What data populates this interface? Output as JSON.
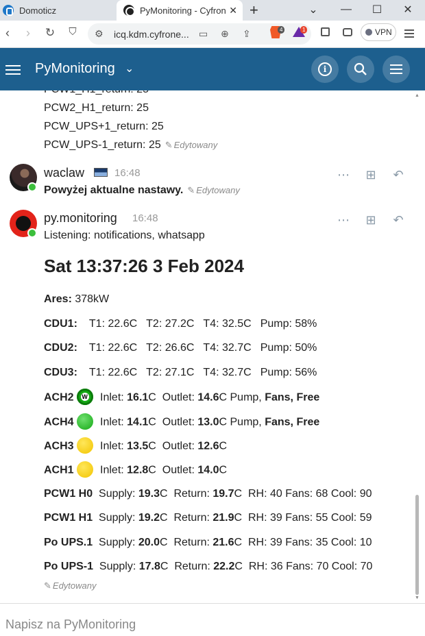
{
  "browser": {
    "tabs": [
      {
        "title": "Domoticz"
      },
      {
        "title": "PyMonitoring - Cyfron"
      }
    ],
    "new_tab": "+",
    "controls": {
      "minimize": "—",
      "maximize": "☐",
      "close": "✕",
      "chevron": "⌄"
    },
    "url": "icq.kdm.cyfrone...",
    "shield_badge": "4",
    "reward_badge": "1",
    "vpn_label": "VPN"
  },
  "app": {
    "title": "PyMonitoring"
  },
  "chat": {
    "prev_lines": [
      "PCW1_H1_return: 25",
      "PCW2_H1_return: 25",
      "PCW_UPS+1_return: 25",
      "PCW_UPS-1_return: 25"
    ],
    "edited_label": "Edytowany",
    "messages": [
      {
        "user": "waclaw",
        "time": "16:48",
        "text": "Powyżej aktualne nastawy."
      },
      {
        "user": "py.monitoring",
        "time": "16:48",
        "text": "Listening: notifications, whatsapp"
      }
    ],
    "report": {
      "datetime": "Sat 13:37:26 3 Feb 2024",
      "ares_label": "Ares:",
      "ares_value": "378kW",
      "cdu": [
        {
          "name": "CDU1:",
          "t1": "T1: 22.6C",
          "t2": "T2: 27.2C",
          "t4": "T4: 32.5C",
          "pump": "Pump: 58%"
        },
        {
          "name": "CDU2:",
          "t1": "T1: 22.6C",
          "t2": "T2: 26.6C",
          "t4": "T4: 32.7C",
          "pump": "Pump: 50%"
        },
        {
          "name": "CDU3:",
          "t1": "T1: 22.6C",
          "t2": "T2: 27.1C",
          "t4": "T4: 32.7C",
          "pump": "Pump: 56%"
        }
      ],
      "ach": [
        {
          "name": "ACH2",
          "inlet": "16.1",
          "outlet": "14.6",
          "status": "green",
          "badge": "W",
          "pump": "Pump,",
          "fans": "Fans,",
          "free": "Free"
        },
        {
          "name": "ACH4",
          "inlet": "14.1",
          "outlet": "13.0",
          "status": "green",
          "badge": "",
          "pump": "Pump,",
          "fans": "Fans,",
          "free": "Free"
        },
        {
          "name": "ACH3",
          "inlet": "13.5",
          "outlet": "12.6",
          "status": "yellow",
          "badge": "",
          "pump": "",
          "fans": "",
          "free": ""
        },
        {
          "name": "ACH1",
          "inlet": "12.8",
          "outlet": "14.0",
          "status": "yellow",
          "badge": "",
          "pump": "",
          "fans": "",
          "free": ""
        }
      ],
      "inlet_label": "Inlet:",
      "outlet_label": "Outlet:",
      "unit_c": "C",
      "pcw": [
        {
          "name": "PCW1 H0",
          "supply": "19.3",
          "ret": "19.7",
          "rest": "RH: 40 Fans: 68 Cool: 90"
        },
        {
          "name": "PCW1 H1",
          "supply": "19.2",
          "ret": "21.9",
          "rest": "RH: 39 Fans: 55 Cool: 59"
        },
        {
          "name": "Po UPS.1",
          "supply": "20.0",
          "ret": "21.6",
          "rest": "RH: 39 Fans: 35 Cool: 10"
        },
        {
          "name": "Po UPS-1",
          "supply": "17.8",
          "ret": "22.2",
          "rest": "RH: 36 Fans: 70 Cool: 70"
        }
      ],
      "supply_label": "Supply:",
      "return_label": "Return:"
    }
  },
  "composer": {
    "placeholder": "Napisz na PyMonitoring"
  }
}
